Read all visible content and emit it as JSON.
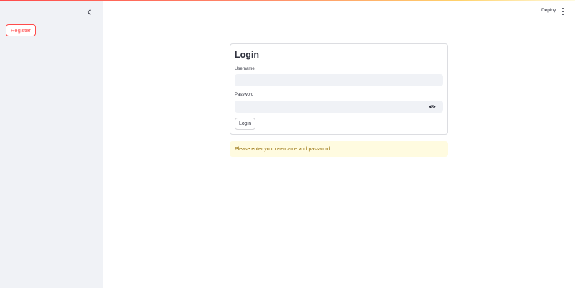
{
  "sidebar": {
    "collapse_icon": "chevron-left-icon",
    "register_label": "Register"
  },
  "header": {
    "deploy_label": "Deploy",
    "menu_icon": "kebab-menu-icon"
  },
  "login_form": {
    "title": "Login",
    "username_label": "Username",
    "username_value": "",
    "password_label": "Password",
    "password_value": "",
    "password_toggle_icon": "eye-icon",
    "submit_label": "Login"
  },
  "alert": {
    "message": "Please enter your username and password"
  },
  "colors": {
    "accent": "#ff4b4b",
    "sidebar_bg": "#f0f2f6",
    "warning_bg": "#fffbe0",
    "warning_text": "#926c05"
  }
}
